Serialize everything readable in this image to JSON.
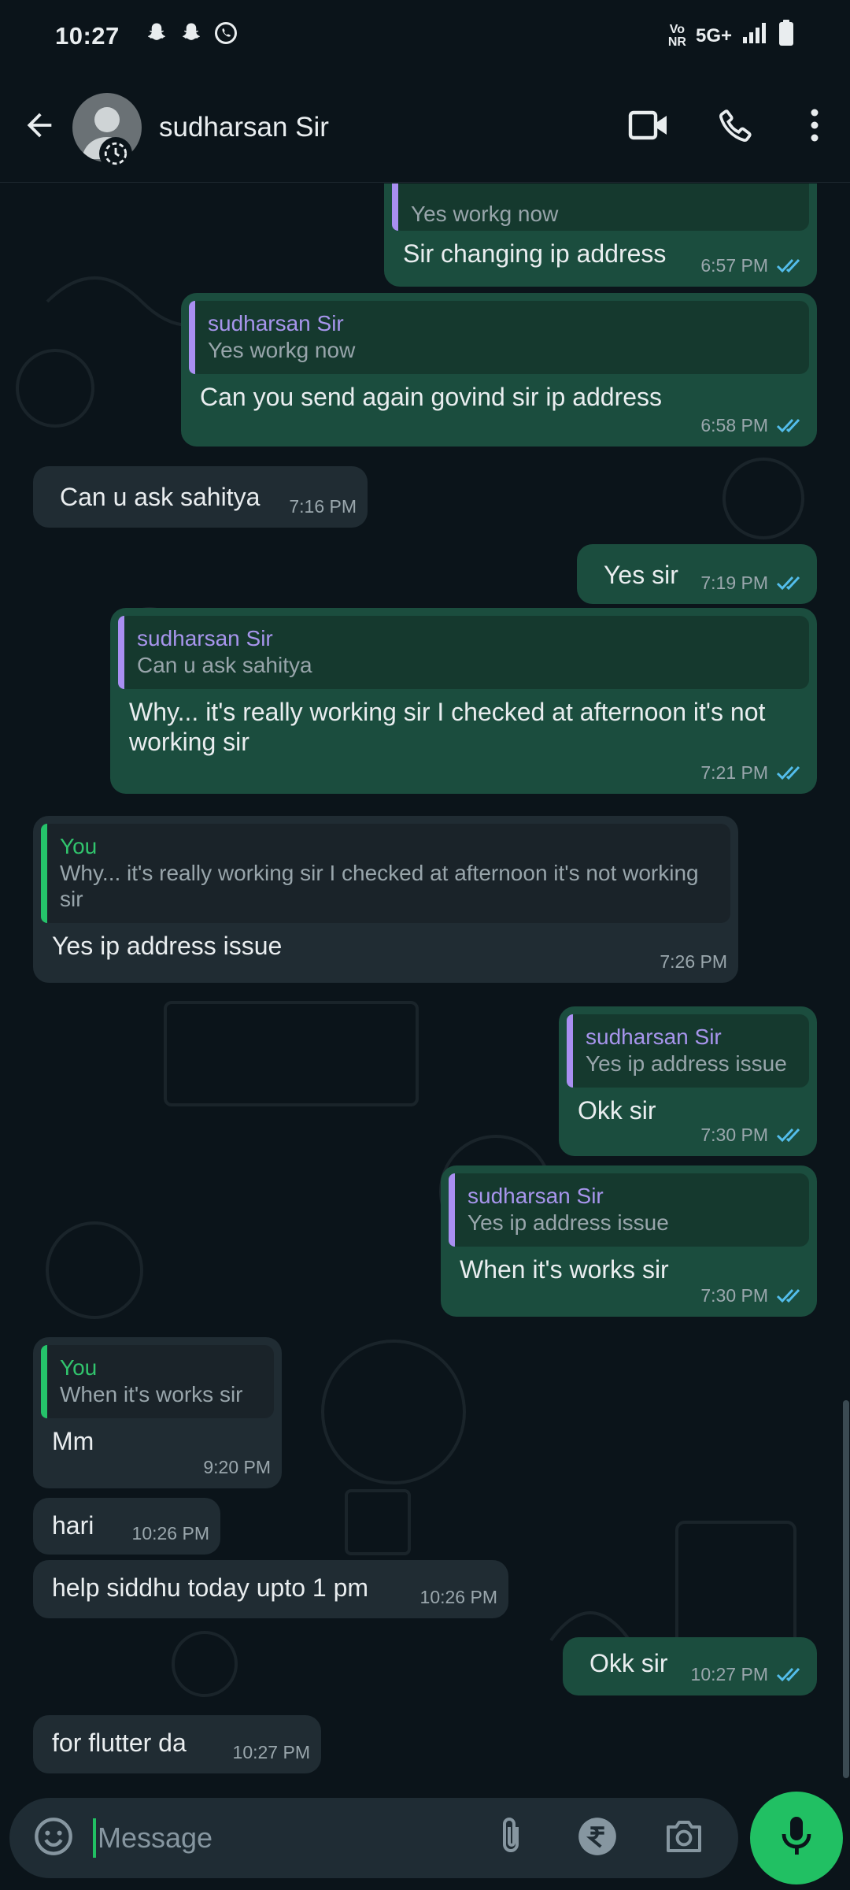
{
  "status_bar": {
    "time": "10:27",
    "network_top": "Vo",
    "network_bottom": "NR",
    "network_type": "5G+"
  },
  "header": {
    "contact_name": "sudharsan Sir",
    "icons": [
      "back-arrow-icon",
      "avatar",
      "video-call-icon",
      "voice-call-icon",
      "more-vert-icon"
    ]
  },
  "messages": [
    {
      "direction": "out",
      "quote_author": "",
      "quote_text": "Yes workg now",
      "text": "Sir changing ip address",
      "time": "6:57 PM",
      "status": "read"
    },
    {
      "direction": "out",
      "quote_author": "sudharsan Sir",
      "quote_text": "Yes workg now",
      "text": "Can you send again govind sir ip address",
      "time": "6:58 PM",
      "status": "read"
    },
    {
      "direction": "in",
      "text": "Can u ask sahitya",
      "time": "7:16 PM"
    },
    {
      "direction": "out",
      "text": "Yes sir",
      "time": "7:19 PM",
      "status": "read"
    },
    {
      "direction": "out",
      "quote_author": "sudharsan Sir",
      "quote_text": "Can u ask sahitya",
      "text": "Why... it's really working sir I checked at afternoon it's not working sir",
      "time": "7:21 PM",
      "status": "read"
    },
    {
      "direction": "in",
      "quote_author": "You",
      "quote_text": "Why... it's really working sir I checked at afternoon it's not working sir",
      "text": "Yes ip address issue",
      "time": "7:26 PM"
    },
    {
      "direction": "out",
      "quote_author": "sudharsan Sir",
      "quote_text": "Yes ip address issue",
      "text": "Okk sir",
      "time": "7:30 PM",
      "status": "read"
    },
    {
      "direction": "out",
      "quote_author": "sudharsan Sir",
      "quote_text": "Yes ip address issue",
      "text": "When it's works sir",
      "time": "7:30 PM",
      "status": "read"
    },
    {
      "direction": "in",
      "quote_author": "You",
      "quote_text": "When it's works sir",
      "text": "Mm",
      "time": "9:20 PM"
    },
    {
      "direction": "in",
      "text": "hari",
      "time": "10:26 PM"
    },
    {
      "direction": "in",
      "text": "help siddhu today upto 1 pm",
      "time": "10:26 PM"
    },
    {
      "direction": "out",
      "text": "Okk sir",
      "time": "10:27 PM",
      "status": "read"
    },
    {
      "direction": "in",
      "text": "for flutter da",
      "time": "10:27 PM"
    }
  ],
  "composer": {
    "placeholder": "Message",
    "icons": [
      "emoji-icon",
      "attach-icon",
      "rupee-payment-icon",
      "camera-icon",
      "mic-icon"
    ]
  },
  "colors": {
    "background": "#0b141a",
    "outgoing_bubble": "#1b4d3e",
    "incoming_bubble": "#202c33",
    "accent_green": "#21c063",
    "read_ticks": "#53bdeb",
    "quote_sir": "#a795ec",
    "quote_you": "#31c46d"
  }
}
